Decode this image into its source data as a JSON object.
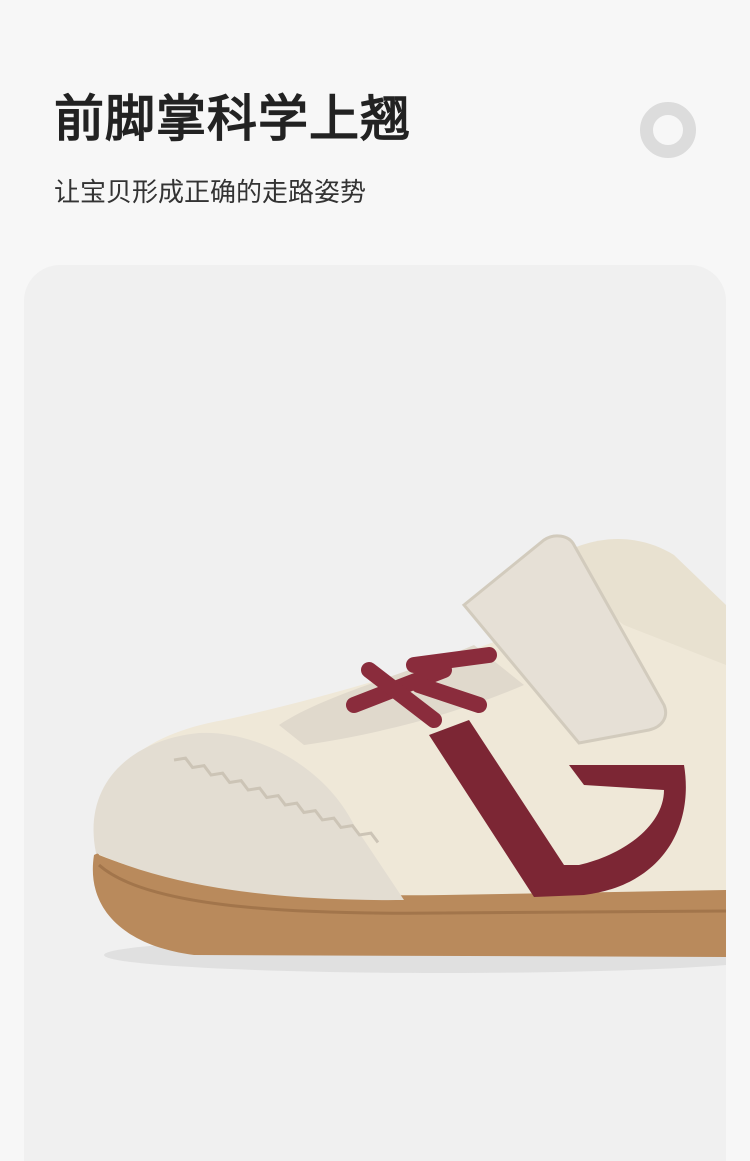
{
  "header": {
    "title": "前脚掌科学上翘",
    "subtitle": "让宝贝形成正确的走路姿势"
  },
  "colors": {
    "background": "#f7f7f7",
    "card": "#f0f0f0",
    "ring": "#dcdcdc",
    "shoe_cream": "#efe8d8",
    "suede": "#e3ddd2",
    "burgundy": "#7c2634",
    "sole": "#b98a5c"
  },
  "product": {
    "image": "kids-sneaker-photo",
    "icon": "decorative-ring-icon"
  }
}
